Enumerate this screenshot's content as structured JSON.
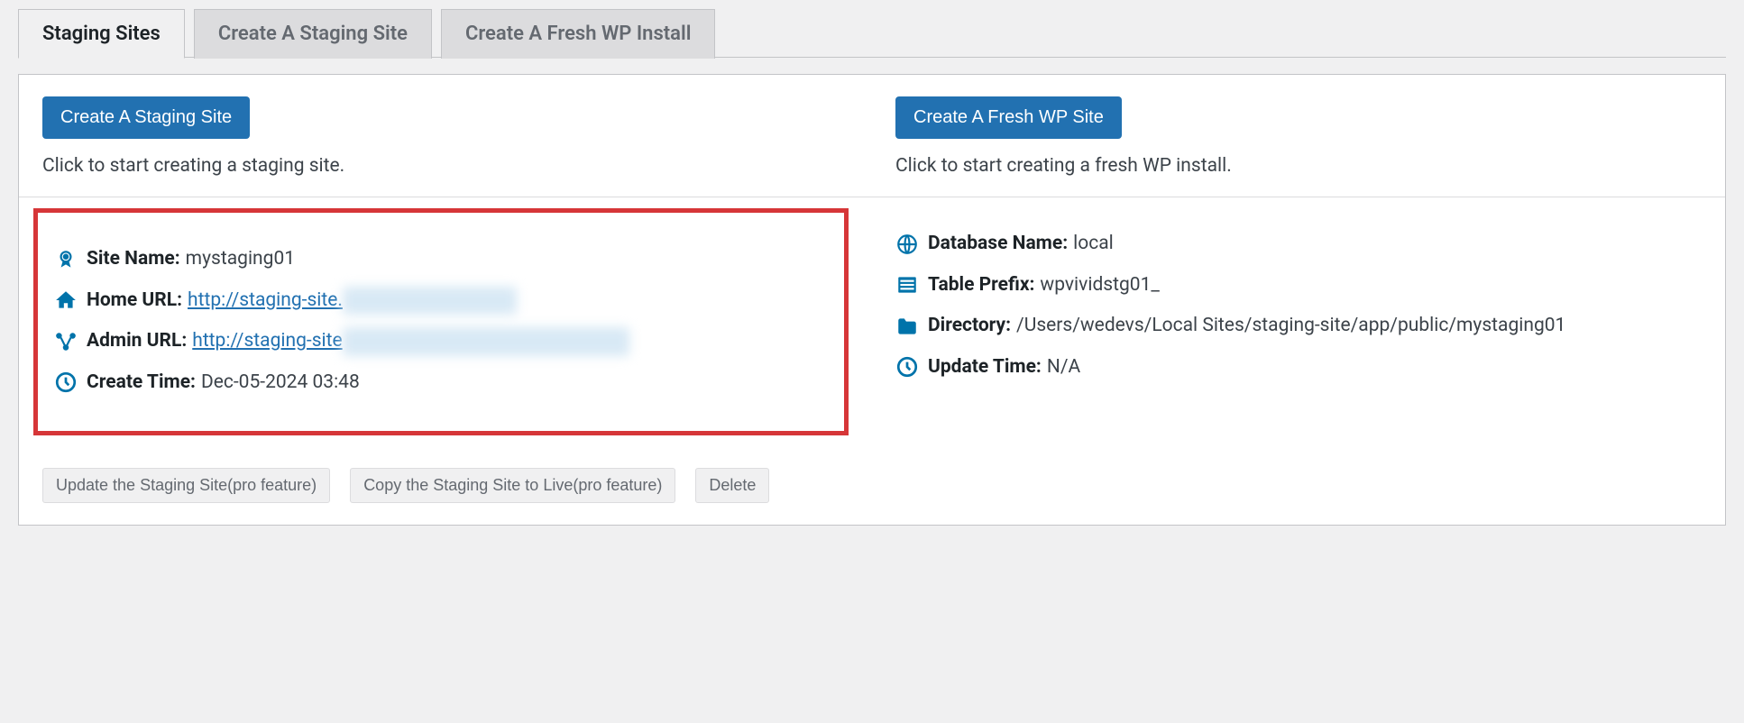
{
  "tabs": {
    "staging_sites": "Staging Sites",
    "create_staging": "Create A Staging Site",
    "create_fresh": "Create A Fresh WP Install"
  },
  "top": {
    "create_staging_btn": "Create A Staging Site",
    "create_staging_hint": "Click to start creating a staging site.",
    "create_fresh_btn": "Create A Fresh WP Site",
    "create_fresh_hint": "Click to start creating a fresh WP install."
  },
  "site": {
    "site_name_label": "Site Name:",
    "site_name_value": "mystaging01",
    "home_url_label": "Home URL:",
    "home_url_value": "http://staging-site.",
    "home_url_hidden": "xxxxxxxxxxxxxxxxx",
    "admin_url_label": "Admin URL:",
    "admin_url_value": "http://staging-site",
    "admin_url_hidden": "xxxxxxxxxxxxxxxxxxxxxxxxxxxxx",
    "create_time_label": "Create Time:",
    "create_time_value": "Dec-05-2024 03:48",
    "db_name_label": "Database Name:",
    "db_name_value": "local",
    "table_prefix_label": "Table Prefix:",
    "table_prefix_value": "wpvividstg01_",
    "directory_label": "Directory:",
    "directory_value": "/Users/wedevs/Local Sites/staging-site/app/public/mystaging01",
    "update_time_label": "Update Time:",
    "update_time_value": "N/A"
  },
  "actions": {
    "update": "Update the Staging Site(pro feature)",
    "copy": "Copy the Staging Site to Live(pro feature)",
    "delete": "Delete"
  }
}
